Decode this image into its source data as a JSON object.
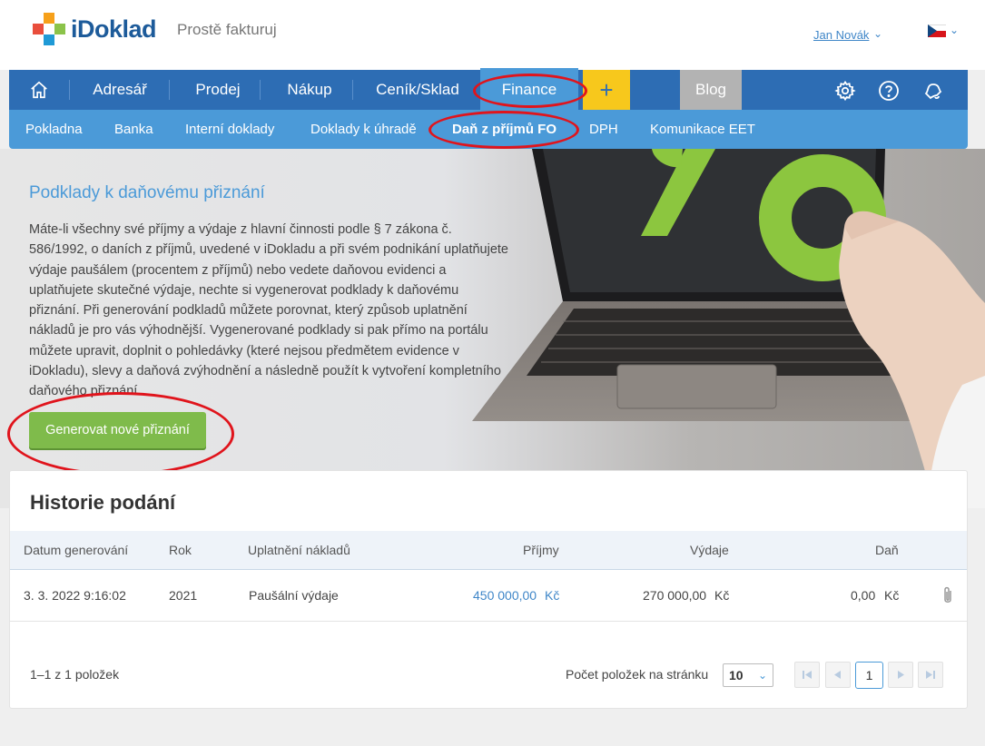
{
  "header": {
    "logo_text": "iDoklad",
    "tagline": "Prostě fakturuj",
    "user": "Jan Novák",
    "language": "cs-flag-icon"
  },
  "mainnav": {
    "home": "home-icon",
    "items": [
      "Adresář",
      "Prodej",
      "Nákup",
      "Ceník/Sklad"
    ],
    "active": "Finance",
    "plus": "+",
    "blog": "Blog",
    "icons": [
      "gear-icon",
      "help-icon",
      "notification-icon"
    ]
  },
  "subnav": {
    "items": [
      "Pokladna",
      "Banka",
      "Interní doklady",
      "Doklady k úhradě",
      "Daň z příjmů FO",
      "DPH",
      "Komunikace EET"
    ],
    "active_index": 4
  },
  "hero": {
    "title": "Podklady k daňovému přiznání",
    "text": "Máte-li všechny své příjmy a výdaje z hlavní činnosti podle § 7 zákona č. 586/1992, o daních z příjmů, uvedené v iDokladu a při svém podnikání uplatňujete výdaje paušálem (procentem z příjmů) nebo vedete daňovou evidenci a uplatňujete skutečné výdaje, nechte si vygenerovat podklady k daňovému přiznání. Při generování podkladů můžete porovnat, který způsob uplatnění nákladů je pro vás výhodnější. Vygenerované podklady si pak přímo na portálu můžete upravit, doplnit o pohledávky (které nejsou předmětem evidence v iDokladu), slevy a daňová zvýhodnění a následně použít k vytvoření kompletního daňového přiznání.",
    "button": "Generovat nové přiznání"
  },
  "history": {
    "title": "Historie podání",
    "columns": [
      "Datum generování",
      "Rok",
      "Uplatnění nákladů",
      "Příjmy",
      "Výdaje",
      "Daň"
    ],
    "rows": [
      {
        "date": "3. 3. 2022 9:16:02",
        "year": "2021",
        "method": "Paušální výdaje",
        "income": "450 000,00",
        "income_cur": "Kč",
        "expense": "270 000,00",
        "expense_cur": "Kč",
        "tax": "0,00",
        "tax_cur": "Kč"
      }
    ],
    "count_text": "1–1 z 1 položek",
    "per_page_label": "Počet položek na stránku",
    "per_page_value": "10",
    "current_page": "1"
  },
  "colors": {
    "nav_blue": "#2d6db4",
    "sub_blue": "#4b9ad8",
    "plus_yellow": "#f7c81c",
    "button_green": "#7fbb4b",
    "annotation_red": "#e0141c"
  }
}
